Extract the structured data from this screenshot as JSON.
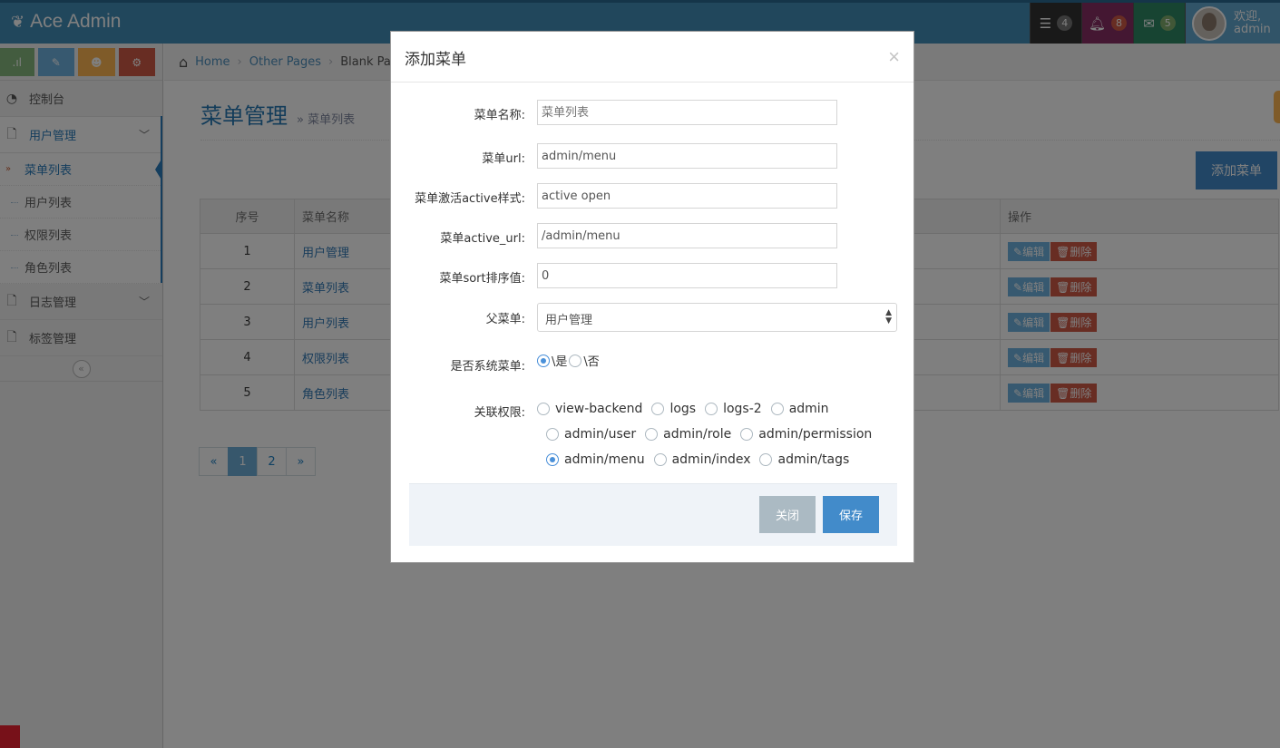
{
  "navbar": {
    "brand": "Ace Admin",
    "tasks_count": "4",
    "notifications_count": "8",
    "messages_count": "5",
    "welcome": "欢迎,",
    "username": "admin"
  },
  "sidebar": {
    "items": [
      {
        "label": "控制台",
        "icon": "dashboard-icon"
      },
      {
        "label": "用户管理",
        "icon": "file-icon"
      },
      {
        "label": "日志管理",
        "icon": "file-icon"
      },
      {
        "label": "标签管理",
        "icon": "file-icon"
      }
    ],
    "submenu": [
      "菜单列表",
      "用户列表",
      "权限列表",
      "角色列表"
    ],
    "collapse": "«"
  },
  "breadcrumbs": {
    "home": "Home",
    "other": "Other Pages",
    "current": "Blank Page"
  },
  "page": {
    "title": "菜单管理",
    "subtitle": "» 菜单列表",
    "add_button": "添加菜单"
  },
  "table": {
    "headers": [
      "序号",
      "菜单名称",
      "操作"
    ],
    "rows": [
      {
        "num": "1",
        "name": "用户管理"
      },
      {
        "num": "2",
        "name": "菜单列表"
      },
      {
        "num": "3",
        "name": "用户列表"
      },
      {
        "num": "4",
        "name": "权限列表"
      },
      {
        "num": "5",
        "name": "角色列表"
      }
    ],
    "edit": "编辑",
    "delete": "删除"
  },
  "pagination": {
    "prev": "«",
    "p1": "1",
    "p2": "2",
    "next": "»"
  },
  "modal": {
    "title": "添加菜单",
    "close_x": "×",
    "fields": {
      "name": {
        "label": "菜单名称:",
        "placeholder": "菜单列表"
      },
      "url": {
        "label": "菜单url:",
        "value": "admin/menu"
      },
      "active_class": {
        "label": "菜单激活active样式:",
        "value": "active open"
      },
      "active_url": {
        "label": "菜单active_url:",
        "value": "/admin/menu"
      },
      "sort": {
        "label": "菜单sort排序值:",
        "value": "0"
      },
      "parent": {
        "label": "父菜单:",
        "value": "用户管理"
      },
      "system": {
        "label": "是否系统菜单:",
        "yes": "\\是",
        "no": "\\否"
      },
      "permissions": {
        "label": "关联权限:",
        "options": [
          "view-backend",
          "logs",
          "logs-2",
          "admin",
          "admin/user",
          "admin/role",
          "admin/permission",
          "admin/menu",
          "admin/index",
          "admin/tags"
        ],
        "selected": "admin/menu"
      }
    },
    "close_button": "关闭",
    "save_button": "保存"
  }
}
